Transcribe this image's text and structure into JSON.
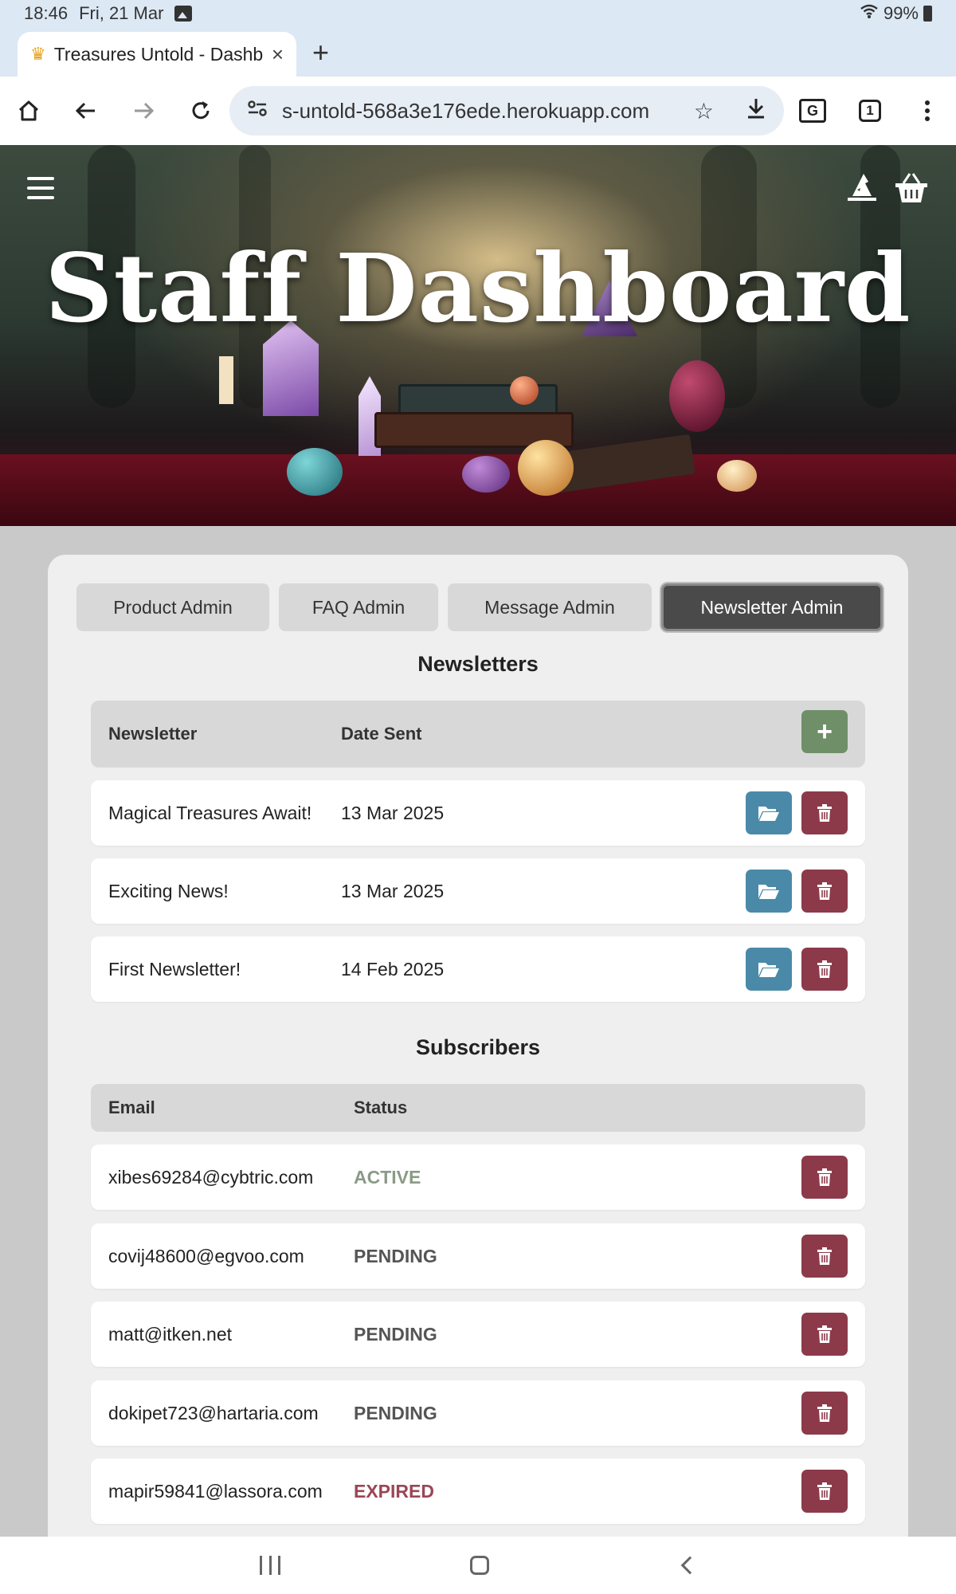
{
  "status_bar": {
    "time": "18:46",
    "date": "Fri, 21 Mar",
    "battery": "99%"
  },
  "browser": {
    "tab_title": "Treasures Untold - Dashb",
    "url": "s-untold-568a3e176ede.herokuapp.com",
    "tab_count": "1",
    "new_tab_symbol": "+"
  },
  "hero": {
    "title": "Staff Dashboard"
  },
  "admin_tabs": [
    {
      "label": "Product Admin",
      "active": false
    },
    {
      "label": "FAQ Admin",
      "active": false
    },
    {
      "label": "Message Admin",
      "active": false
    },
    {
      "label": "Newsletter Admin",
      "active": true
    }
  ],
  "newsletters": {
    "title": "Newsletters",
    "columns": [
      "Newsletter",
      "Date Sent"
    ],
    "add_symbol": "+",
    "rows": [
      {
        "name": "Magical Treasures Await!",
        "date": "13 Mar 2025"
      },
      {
        "name": "Exciting News!",
        "date": "13 Mar 2025"
      },
      {
        "name": "First Newsletter!",
        "date": "14 Feb 2025"
      }
    ]
  },
  "subscribers": {
    "title": "Subscribers",
    "columns": [
      "Email",
      "Status"
    ],
    "rows": [
      {
        "email": "xibes69284@cybtric.com",
        "status": "ACTIVE"
      },
      {
        "email": "covij48600@egvoo.com",
        "status": "PENDING"
      },
      {
        "email": "matt@itken.net",
        "status": "PENDING"
      },
      {
        "email": "dokipet723@hartaria.com",
        "status": "PENDING"
      },
      {
        "email": "mapir59841@lassora.com",
        "status": "EXPIRED"
      }
    ]
  },
  "colors": {
    "status_active": "#8a9a86",
    "status_pending": "#555555",
    "status_expired": "#9a4656",
    "open_button": "#4a8aa8",
    "delete_button": "#8c3a4a",
    "add_button": "#6f8f68",
    "active_tab": "#4a4a4a"
  },
  "icons": {
    "open": "folder-open-icon",
    "delete": "trash-icon",
    "add": "plus-icon",
    "menu": "hamburger-menu-icon",
    "account": "wizard-hat-icon",
    "cart": "basket-icon"
  }
}
